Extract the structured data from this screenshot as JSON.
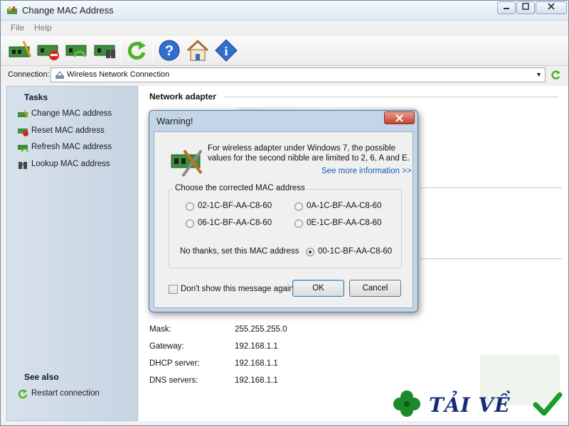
{
  "window": {
    "title": "Change MAC Address",
    "min": "0",
    "max": "1",
    "close": "r"
  },
  "menu": {
    "file": "File",
    "help": "Help"
  },
  "connection": {
    "label": "Connection:",
    "value": "Wireless Network Connection"
  },
  "sidebar": {
    "tasks_heading": "Tasks",
    "tasks": [
      {
        "label": "Change MAC address"
      },
      {
        "label": "Reset MAC address"
      },
      {
        "label": "Refresh MAC address"
      },
      {
        "label": "Lookup MAC address"
      }
    ],
    "see_also_heading": "See also",
    "see_also": [
      {
        "label": "Restart connection"
      }
    ]
  },
  "content": {
    "section_title": "Network adapter",
    "rows": [
      {
        "label": "Mask:",
        "value": "255.255.255.0"
      },
      {
        "label": "Gateway:",
        "value": "192.168.1.1"
      },
      {
        "label": "DHCP server:",
        "value": "192.168.1.1"
      },
      {
        "label": "DNS servers:",
        "value": "192.168.1.1"
      }
    ]
  },
  "dialog": {
    "title": "Warning!",
    "close": "X",
    "message_line1": "For wireless adapter under Windows 7, the possible",
    "message_line2": "values for the second nibble are limited to 2, 6, A and E.",
    "link": "See more information >>",
    "group_label": "Choose the corrected MAC address",
    "options": [
      {
        "value": "02-1C-BF-AA-C8-60",
        "selected": false
      },
      {
        "value": "0A-1C-BF-AA-C8-60",
        "selected": false
      },
      {
        "value": "06-1C-BF-AA-C8-60",
        "selected": false
      },
      {
        "value": "0E-1C-BF-AA-C8-60",
        "selected": false
      }
    ],
    "keep_label": "No thanks, set this MAC address",
    "keep_value": "00-1C-BF-AA-C8-60",
    "keep_selected": true,
    "dont_show": "Don't show this message again",
    "ok": "OK",
    "cancel": "Cancel"
  },
  "watermark": {
    "text": "TẢI VỀ"
  }
}
